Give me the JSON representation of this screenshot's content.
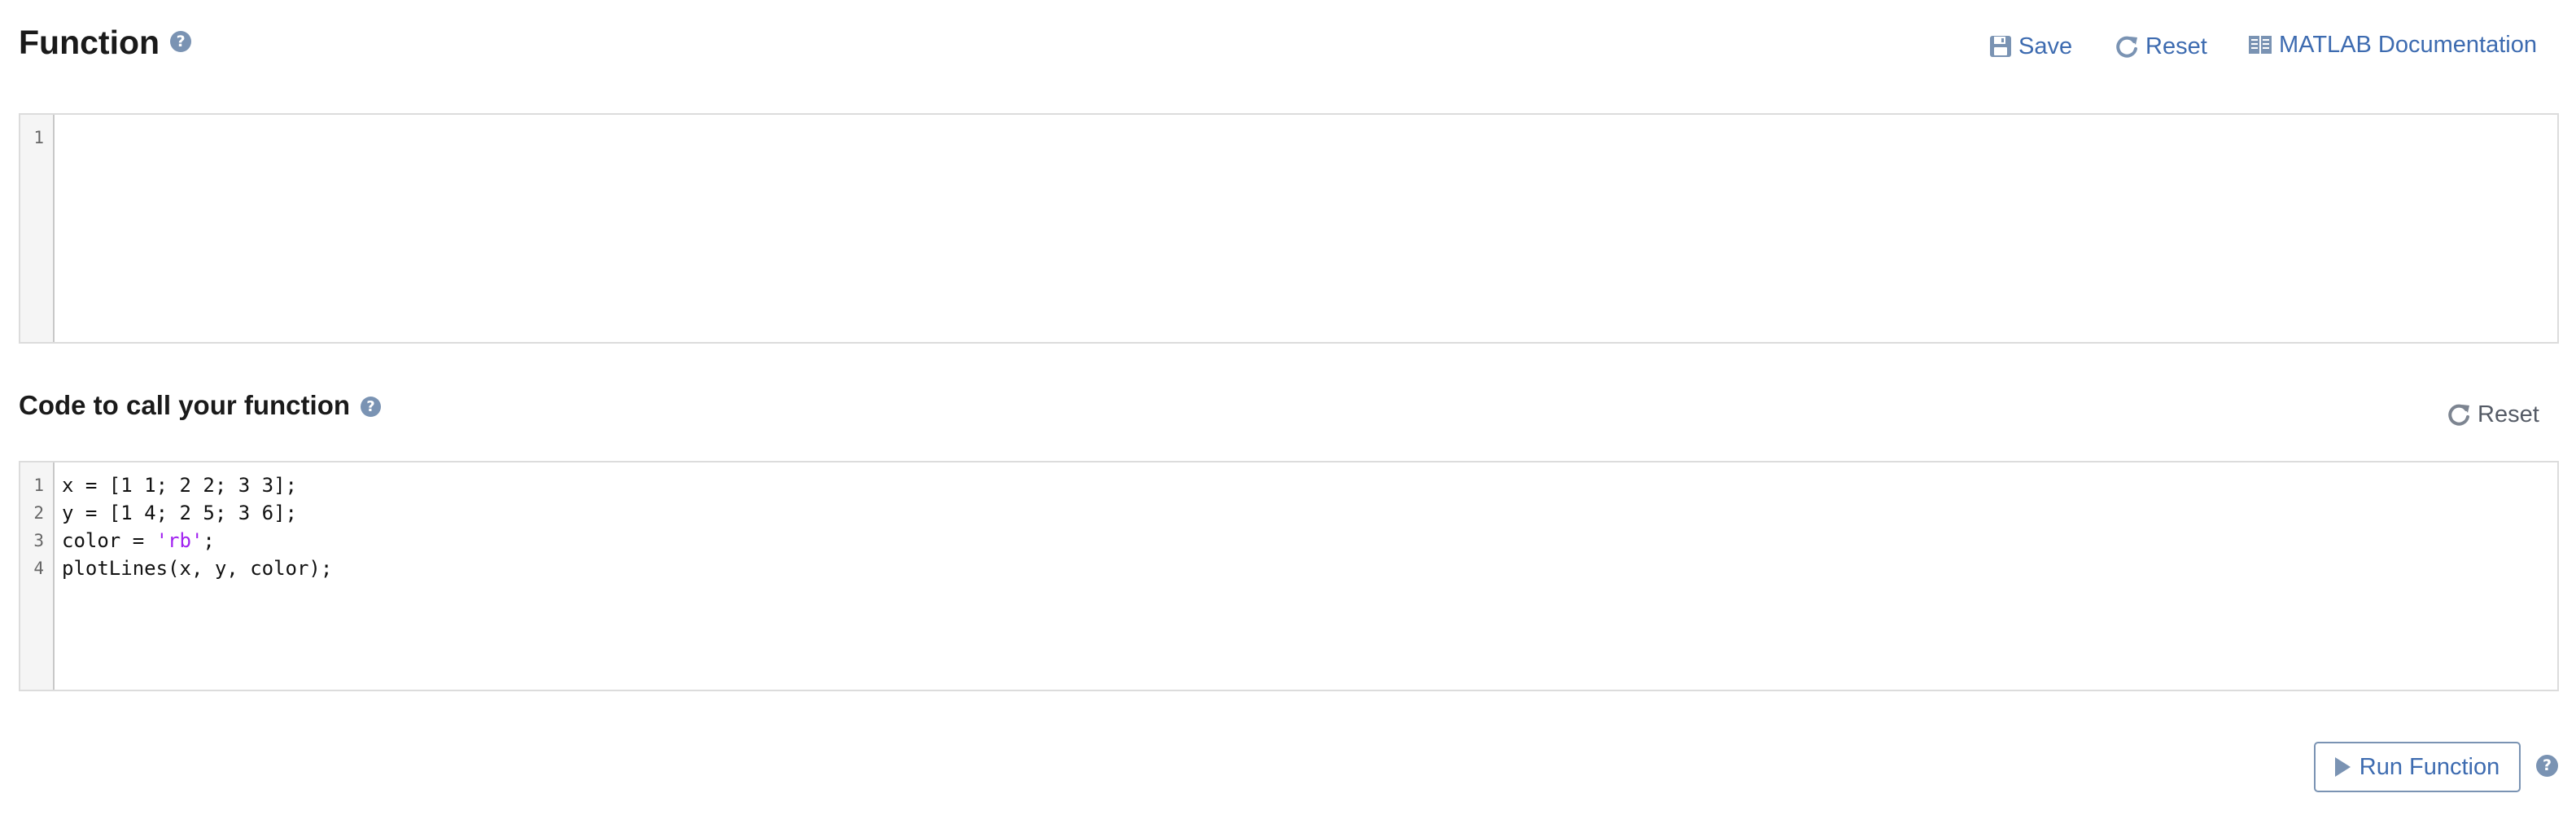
{
  "function_section": {
    "title": "Function",
    "help_icon": "question-circle-icon",
    "toolbar": {
      "save_label": "Save",
      "reset_label": "Reset",
      "doc_label": "MATLAB Documentation"
    },
    "editor": {
      "line_numbers": [
        "1"
      ],
      "lines": [
        ""
      ]
    }
  },
  "call_section": {
    "title": "Code to call your function",
    "help_icon": "question-circle-icon",
    "reset_label": "Reset",
    "editor": {
      "line_numbers": [
        "1",
        "2",
        "3",
        "4"
      ],
      "lines": [
        {
          "plain": "x = [1 1; 2 2; 3 3];"
        },
        {
          "plain": "y = [1 4; 2 5; 3 6];"
        },
        {
          "pre": "color = ",
          "str": "'rb'",
          "post": ";"
        },
        {
          "plain": "plotLines(x, y, color);"
        }
      ]
    }
  },
  "run": {
    "label": "Run Function",
    "help_icon": "question-circle-icon"
  },
  "colors": {
    "accent": "#3d6bb0",
    "icon_gray": "#7a93b3",
    "string_literal": "#a020f0",
    "editor_border": "#dcdcdc"
  }
}
